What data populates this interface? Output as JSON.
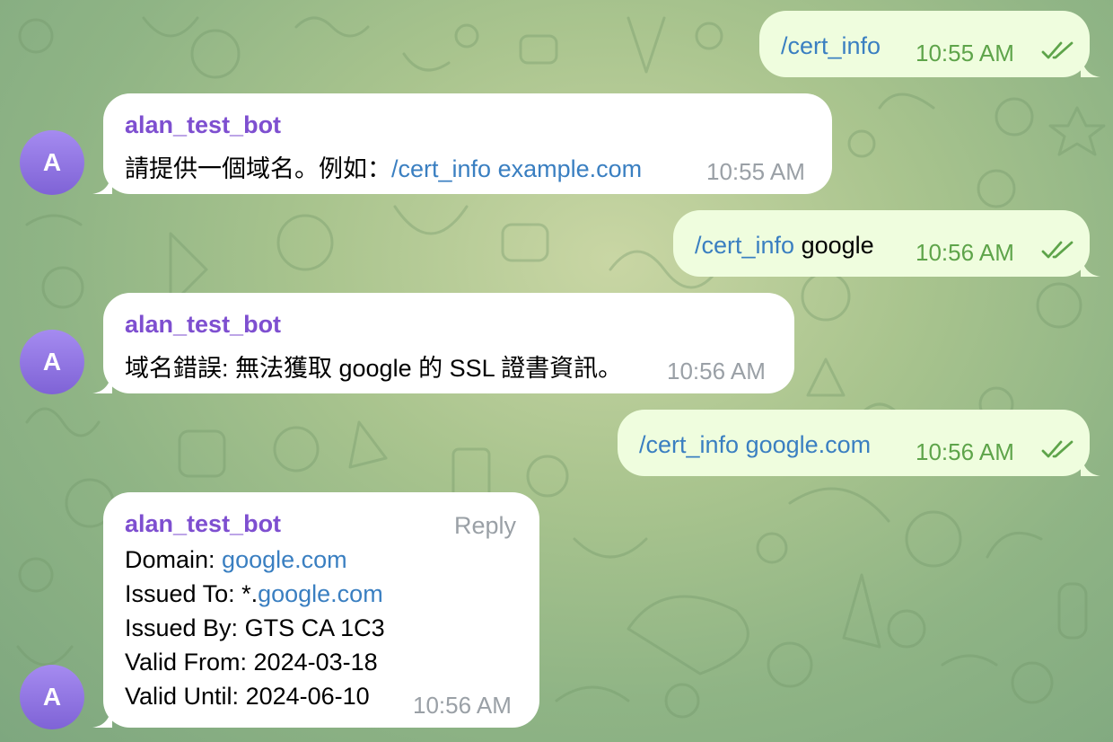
{
  "messages": [
    {
      "id": "m1",
      "dir": "out",
      "parts": [
        {
          "text": "/cert_info",
          "kind": "cmd"
        }
      ],
      "time": "10:55 AM",
      "status_icon": "double-check-icon"
    },
    {
      "id": "m2",
      "dir": "in",
      "sender": "alan_test_bot",
      "parts": [
        {
          "text": "請提供一個域名。例如：",
          "kind": "plain"
        },
        {
          "text": "/cert_info",
          "kind": "cmd"
        },
        {
          "text": " example.com",
          "kind": "link"
        }
      ],
      "time": "10:55 AM"
    },
    {
      "id": "m3",
      "dir": "out",
      "parts": [
        {
          "text": "/cert_info",
          "kind": "cmd"
        },
        {
          "text": " google",
          "kind": "plain"
        }
      ],
      "time": "10:56 AM",
      "status_icon": "double-check-icon"
    },
    {
      "id": "m4",
      "dir": "in",
      "sender": "alan_test_bot",
      "parts": [
        {
          "text": "域名錯誤: 無法獲取 google 的 SSL 證書資訊。",
          "kind": "plain"
        }
      ],
      "time": "10:56 AM"
    },
    {
      "id": "m5",
      "dir": "out",
      "parts": [
        {
          "text": "/cert_info",
          "kind": "cmd"
        },
        {
          "text": " google.com",
          "kind": "link"
        }
      ],
      "time": "10:56 AM",
      "status_icon": "double-check-icon"
    },
    {
      "id": "m6",
      "dir": "in",
      "sender": "alan_test_bot",
      "reply_label": "Reply",
      "lines": [
        {
          "label": "Domain: ",
          "value": "google.com",
          "value_kind": "link"
        },
        {
          "label": "Issued To: *.",
          "value": "google.com",
          "value_kind": "link"
        },
        {
          "label": "Issued By: ",
          "value": "GTS CA 1C3",
          "value_kind": "plain"
        },
        {
          "label": "Valid From: ",
          "value": "2024-03-18",
          "value_kind": "plain"
        },
        {
          "label": "Valid Until: ",
          "value": "2024-06-10",
          "value_kind": "plain"
        }
      ],
      "time": "10:56 AM"
    }
  ],
  "avatar_letter": "A",
  "colors": {
    "sender": "#7e4fd0",
    "link": "#3a7fc1",
    "outgoing_bubble": "#effdde",
    "outgoing_time": "#5ea44a",
    "incoming_time": "#9aa0a6"
  }
}
